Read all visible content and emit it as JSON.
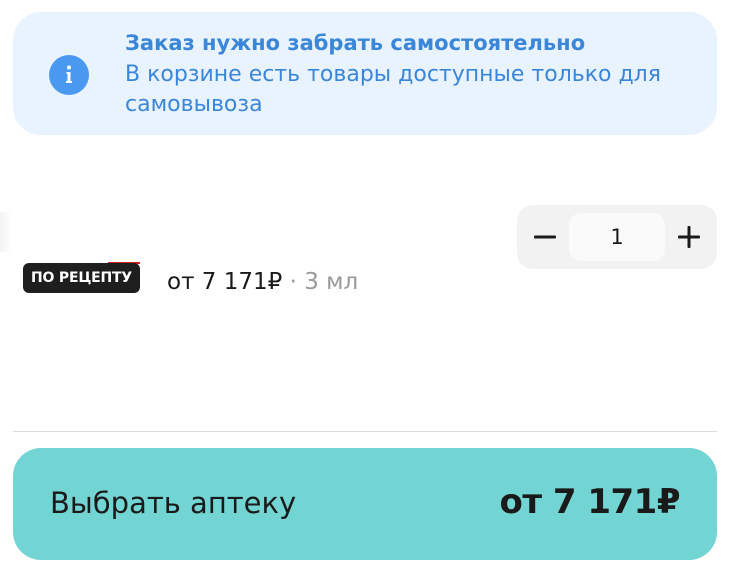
{
  "banner": {
    "title": "Заказ нужно забрать самостоятельно",
    "text": "В корзине есть товары доступные только для самовывоза",
    "icon": "info-icon",
    "accent_color": "#3a86d8"
  },
  "item": {
    "badge": "ПО РЕЦЕПТУ",
    "price": "от 7 171₽",
    "separator": "·",
    "volume": "3 мл",
    "quantity": "1",
    "minus_icon": "minus-icon",
    "plus_icon": "plus-icon"
  },
  "cta": {
    "label": "Выбрать аптеку",
    "price": "от 7 171₽",
    "color": "#72d5d3"
  }
}
